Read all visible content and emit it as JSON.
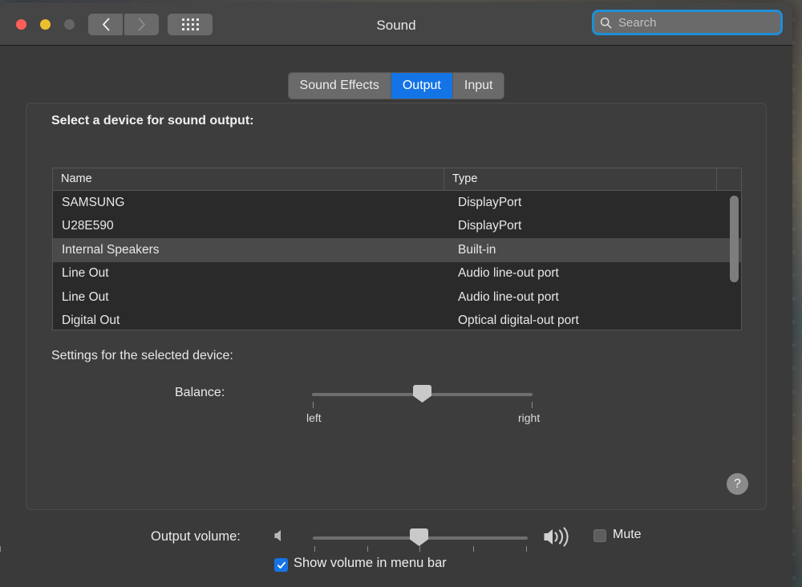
{
  "window": {
    "title": "Sound",
    "traffic_lights": {
      "close": "close-button",
      "minimize": "minimize-button",
      "zoom": "zoom-button"
    },
    "back_icon": "chevron-left-icon",
    "forward_icon": "chevron-right-icon",
    "showall_icon": "grid-dots-icon"
  },
  "search": {
    "placeholder": "Search",
    "value": "",
    "icon": "search-icon",
    "focus_ring_color": "#1f8fd6"
  },
  "tabs": [
    {
      "label": "Sound Effects",
      "active": false
    },
    {
      "label": "Output",
      "active": true
    },
    {
      "label": "Input",
      "active": false
    }
  ],
  "panel": {
    "title": "Select a device for sound output:",
    "settings_label": "Settings for the selected device:",
    "help_label": "?"
  },
  "device_table": {
    "columns": [
      "Name",
      "Type"
    ],
    "rows": [
      {
        "name": "SAMSUNG",
        "type": "DisplayPort",
        "selected": false
      },
      {
        "name": "U28E590",
        "type": "DisplayPort",
        "selected": false
      },
      {
        "name": "Internal Speakers",
        "type": "Built-in",
        "selected": true
      },
      {
        "name": "Line Out",
        "type": "Audio line-out port",
        "selected": false
      },
      {
        "name": "Line Out",
        "type": "Audio line-out port",
        "selected": false
      },
      {
        "name": "Digital Out",
        "type": "Optical digital-out port",
        "selected": false
      }
    ],
    "scrollbar": "vertical-scrollbar"
  },
  "balance": {
    "label": "Balance:",
    "left_label": "left",
    "right_label": "right",
    "value_percent": 50
  },
  "output_volume": {
    "label": "Output volume:",
    "value_percent": 45,
    "low_icon": "speaker-quiet-icon",
    "high_icon": "speaker-loud-icon",
    "mute_label": "Mute",
    "mute_checked": false
  },
  "show_volume": {
    "label": "Show volume in menu bar",
    "checked": true,
    "check_glyph": "✓"
  },
  "colors": {
    "accent_blue": "#1474e6",
    "window_bg": "#3a3a3a",
    "toolbar_bg": "#454545",
    "panel_bg": "#3d3d3d",
    "table_bg": "#2a2a2a",
    "row_selected": "#4a4a4a"
  }
}
